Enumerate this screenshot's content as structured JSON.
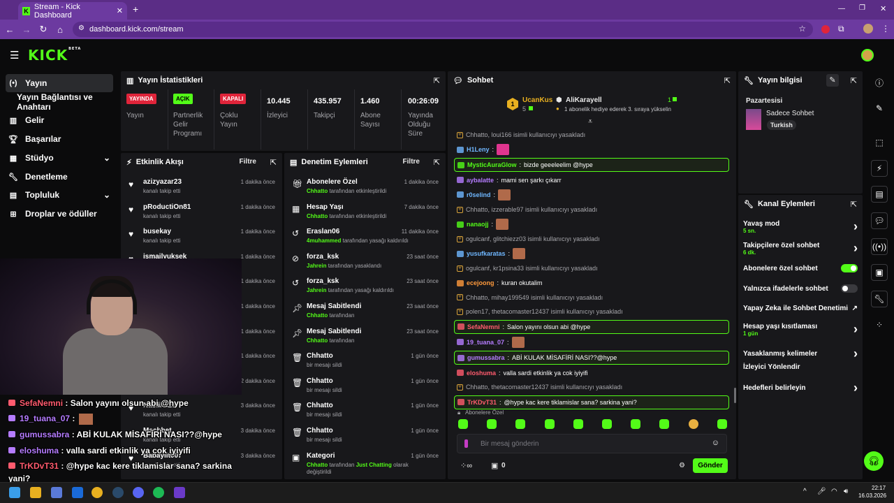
{
  "browser": {
    "tab_title": "Stream - Kick Dashboard",
    "new_tab": "+",
    "url": "dashboard.kick.com/stream"
  },
  "logo": {
    "text": "KICK",
    "beta": "BETA"
  },
  "sidebar": {
    "items": [
      {
        "label": "Yayın",
        "icon": "stream-icon"
      },
      {
        "label": "Yayın Bağlantısı ve Anahtarı",
        "icon": ""
      },
      {
        "label": "Gelir",
        "icon": "revenue-icon"
      },
      {
        "label": "Başarılar",
        "icon": "trophy-icon"
      },
      {
        "label": "Stüdyo",
        "icon": "studio-icon"
      },
      {
        "label": "Denetleme",
        "icon": "wrench-icon"
      },
      {
        "label": "Topluluk",
        "icon": "community-icon"
      },
      {
        "label": "Droplar ve ödüller",
        "icon": "drops-icon"
      }
    ]
  },
  "stats": {
    "title": "Yayın İstatistikleri",
    "items": [
      {
        "badge": "YAYINDA",
        "label": "Yayın",
        "color": "#e0243a"
      },
      {
        "badge": "AÇIK",
        "label": "Partnerlik Gelir Programı",
        "color": "#53fc18"
      },
      {
        "badge": "KAPALI",
        "label": "Çoklu Yayın",
        "color": "#e0243a"
      },
      {
        "value": "10.445",
        "label": "İzleyici"
      },
      {
        "value": "435.957",
        "label": "Takipçi"
      },
      {
        "value": "1.460",
        "label": "Abone Sayısı"
      },
      {
        "value": "00:26:09",
        "label": "Yayında Olduğu Süre"
      }
    ]
  },
  "activity": {
    "title": "Etkinlik Akışı",
    "filter": "Filtre",
    "rows": [
      {
        "name": "azizyazar23",
        "sub": "kanalı takip etti",
        "time": "1 dakika önce"
      },
      {
        "name": "pRoductiOn81",
        "sub": "kanalı takip etti",
        "time": "1 dakika önce"
      },
      {
        "name": "busekay",
        "sub": "kanalı takip etti",
        "time": "1 dakika önce"
      },
      {
        "name": "ismailyuksek",
        "sub": "kanalı takip etti",
        "time": "1 dakika önce"
      },
      {
        "name": "",
        "sub": "",
        "time": "1 dakika önce"
      },
      {
        "name": "",
        "sub": "",
        "time": "1 dakika önce"
      },
      {
        "name": "",
        "sub": "",
        "time": "1 dakika önce"
      },
      {
        "name": "",
        "sub": "",
        "time": "1 dakika önce"
      },
      {
        "name": "",
        "sub": "",
        "time": "2 dakika önce"
      },
      {
        "name": "Nasliha23",
        "sub": "kanalı takip etti",
        "time": "3 dakika önce"
      },
      {
        "name": "Macbbet",
        "sub": "kanalı takip etti",
        "time": "3 dakika önce"
      },
      {
        "name": "Babayiit007",
        "sub": "kanalı takip etti",
        "time": "3 dakika önce"
      }
    ]
  },
  "moderation": {
    "title": "Denetim Eylemleri",
    "filter": "Filtre",
    "rows": [
      {
        "icon": "gift-icon",
        "name": "Abonelere Özel",
        "actor": "Chhatto",
        "sub": "tarafından etkinleştirildi",
        "time": "1 dakika önce"
      },
      {
        "icon": "calendar-icon",
        "name": "Hesap Yaşı",
        "actor": "Chhatto",
        "sub": "tarafından etkinleştirildi",
        "time": "7 dakika önce"
      },
      {
        "icon": "undo-icon",
        "name": "Eraslan06",
        "actor": "4muhammed",
        "sub": "tarafından yasağı kaldırıldı",
        "time": "11 dakika önce"
      },
      {
        "icon": "ban-icon",
        "name": "forza_ksk",
        "actor": "Jahrein",
        "sub": "tarafından yasaklandı",
        "time": "23 saat önce"
      },
      {
        "icon": "undo-icon",
        "name": "forza_ksk",
        "actor": "Jahrein",
        "sub": "tarafından yasağı kaldırıldı",
        "time": "23 saat önce"
      },
      {
        "icon": "pin-icon",
        "name": "Mesaj Sabitlendi",
        "actor": "Chhatto",
        "sub": "tarafından",
        "time": "23 saat önce"
      },
      {
        "icon": "pin-icon",
        "name": "Mesaj Sabitlendi",
        "actor": "Chhatto",
        "sub": "tarafından",
        "time": "23 saat önce"
      },
      {
        "icon": "trash-icon",
        "name": "Chhatto",
        "actor": "",
        "sub": "bir mesajı sildi",
        "time": "1 gün önce"
      },
      {
        "icon": "trash-icon",
        "name": "Chhatto",
        "actor": "",
        "sub": "bir mesajı sildi",
        "time": "1 gün önce"
      },
      {
        "icon": "trash-icon",
        "name": "Chhatto",
        "actor": "",
        "sub": "bir mesajı sildi",
        "time": "1 gün önce"
      },
      {
        "icon": "trash-icon",
        "name": "Chhatto",
        "actor": "",
        "sub": "bir mesajı sildi",
        "time": "1 gün önce"
      },
      {
        "icon": "category-icon",
        "name": "Kategori",
        "actor": "Chhatto",
        "sub": "tarafından",
        "extra": "Just Chatting",
        "extra2": "olarak değiştirildi",
        "time": "1 gün önce"
      }
    ]
  },
  "chat": {
    "title": "Sohbet",
    "top_gifter": {
      "rank": "1",
      "name": "UcanKus",
      "count": "5"
    },
    "gift_user": {
      "name": "AliKarayell",
      "count": "1",
      "note": "1 abonelik hediye ederek 3. sıraya yükselin"
    },
    "messages": [
      {
        "type": "sys",
        "text": "Chhatto, loui166 isimli kullanıcıyı yasakladı"
      },
      {
        "type": "emote",
        "user": "H1Leny",
        "color": "#6fb7ff",
        "text": "",
        "emote": "pink"
      },
      {
        "type": "hl",
        "user": "MysticAuraGlow",
        "color": "#53fc18",
        "text": "bizde geeeleelim @hype"
      },
      {
        "type": "msg",
        "user": "aybalatte",
        "color": "#b57cff",
        "text": "mami sen şarkı çıkarr"
      },
      {
        "type": "emote",
        "user": "r0selind",
        "color": "#6fb7ff",
        "text": ""
      },
      {
        "type": "sys",
        "text": "Chhatto, izzerable97 isimli kullanıcıyı yasakladı"
      },
      {
        "type": "emote",
        "user": "nanaojj",
        "color": "#53fc18",
        "text": ""
      },
      {
        "type": "sys",
        "text": "ogulcanf, glitchiezz03 isimli kullanıcıyı yasakladı"
      },
      {
        "type": "emote",
        "user": "yusufkaratas",
        "color": "#6fb7ff",
        "text": ""
      },
      {
        "type": "sys",
        "text": "ogulcanf, kr1psina33 isimli kullanıcıyı yasakladı"
      },
      {
        "type": "msg",
        "user": "ecejoong",
        "color": "#ff9a3c",
        "text": "kuran okutalim"
      },
      {
        "type": "sys",
        "text": "Chhatto, mihay199549 isimli kullanıcıyı yasakladı"
      },
      {
        "type": "sys",
        "text": "polen17, thetacomaster12437 isimli kullanıcıyı yasakladı"
      },
      {
        "type": "hl",
        "user": "SefaNemni",
        "color": "#ff5b6e",
        "text": "Salon yayını olsun abi @hype"
      },
      {
        "type": "emote",
        "user": "19_tuana_07",
        "color": "#b57cff",
        "text": ""
      },
      {
        "type": "hl",
        "user": "gumussabra",
        "color": "#b57cff",
        "text": "ABİ KULAK MİSAFİRİ NASI??@hype"
      },
      {
        "type": "msg",
        "user": "eloshuma",
        "color": "#ff5b6e",
        "text": "valla sardi etkinlik ya cok iyiyifi"
      },
      {
        "type": "sys",
        "text": "Chhatto, thetacomaster12437 isimli kullanıcıyı yasakladı"
      },
      {
        "type": "hl",
        "user": "TrKDvT31",
        "color": "#ff5b6e",
        "text": "@hype kac kere tiklamislar sana? sarkina yani?"
      }
    ],
    "emote_section": "Abonelere Özel",
    "input_placeholder": "Bir mesaj gönderin",
    "points": "0",
    "send": "Gönder"
  },
  "stream_info": {
    "title": "Yayın bilgisi",
    "day": "Pazartesisi",
    "category": "Sadece Sohbet",
    "tag": "Turkish"
  },
  "channel_actions": {
    "title": "Kanal Eylemleri",
    "rows": [
      {
        "label": "Yavaş mod",
        "sub": "5 sn.",
        "control": "chevron"
      },
      {
        "label": "Takipçilere özel sohbet",
        "sub": "6 dk.",
        "control": "chevron"
      },
      {
        "label": "Abonelere özel sohbet",
        "sub": "",
        "control": "on"
      },
      {
        "label": "Yalnızca ifadelerle sohbet",
        "sub": "",
        "control": "off"
      },
      {
        "label": "Yapay Zeka ile Sohbet Denetimi",
        "sub": "",
        "control": "external"
      },
      {
        "label": "Hesap yaşı kısıtlaması",
        "sub": "1 gün",
        "control": "chevron"
      },
      {
        "label": "Yasaklanmış kelimeler",
        "sub": "",
        "control": "chevron"
      },
      {
        "label": "İzleyici Yönlendir",
        "sub": "",
        "control": ""
      },
      {
        "label": "Hedefleri belirleyin",
        "sub": "",
        "control": "chevron"
      }
    ]
  },
  "overlay_chat": [
    {
      "user": "SefaNemni",
      "color": "#ff5b6e",
      "text": ": Salon yayını olsun abi @hype"
    },
    {
      "user": "19_tuana_07",
      "color": "#b57cff",
      "text": ":"
    },
    {
      "user": "gumussabra",
      "color": "#b57cff",
      "text": ": ABİ KULAK MİSAFİRİ NASI??@hype"
    },
    {
      "user": "eloshuma",
      "color": "#b57cff",
      "text": ": valla sardi etkinlik ya cok iyiyifi"
    },
    {
      "user": "TrKDvT31",
      "color": "#ff5b6e",
      "text": ": @hype kac kere tiklamislar sana? sarkina"
    },
    {
      "user": "",
      "color": "#fff",
      "text": "yani?"
    }
  ],
  "taskbar": {
    "time": "22:17",
    "date": "16.03.2026"
  }
}
